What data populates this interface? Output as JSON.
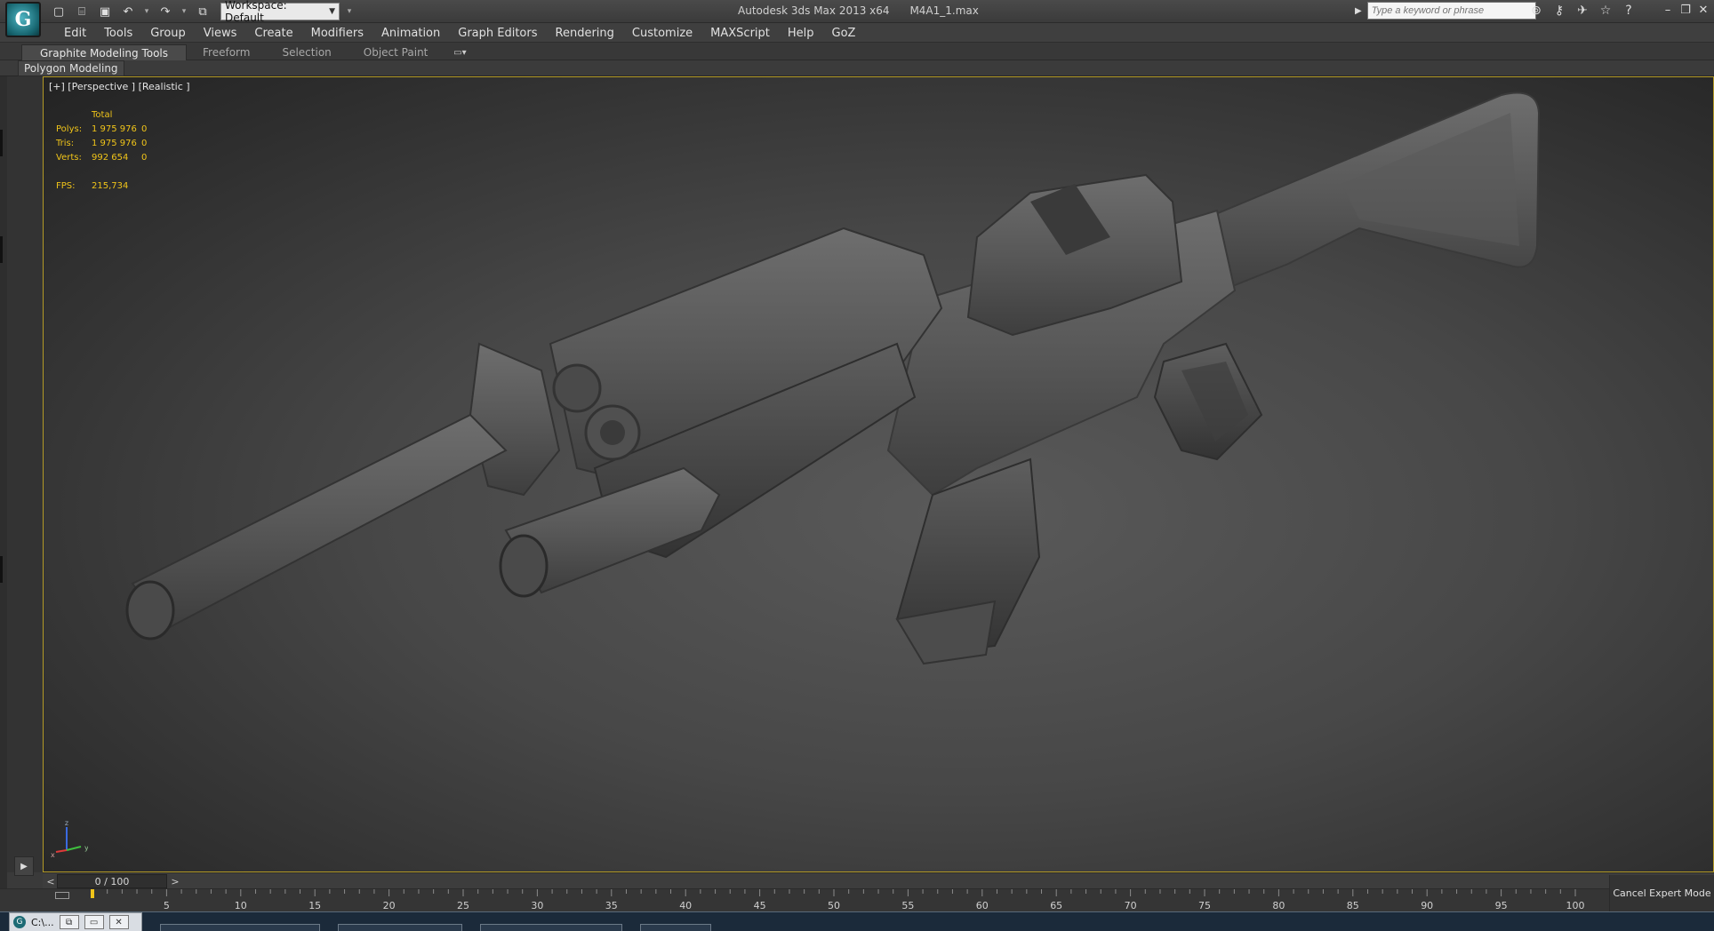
{
  "app": {
    "logo": "G",
    "title": "Autodesk 3ds Max  2013 x64",
    "file": "M4A1_1.max"
  },
  "quick_access": {
    "workspace_label": "Workspace: Default",
    "icons": [
      "new-file-icon",
      "open-folder-icon",
      "save-icon",
      "undo-icon",
      "redo-icon",
      "project-folder-icon"
    ]
  },
  "search": {
    "placeholder": "Type a keyword or phrase"
  },
  "title_icons": [
    "binoculars-icon",
    "key-icon",
    "communication-icon",
    "star-icon",
    "help-icon"
  ],
  "menu": {
    "items": [
      "Edit",
      "Tools",
      "Group",
      "Views",
      "Create",
      "Modifiers",
      "Animation",
      "Graph Editors",
      "Rendering",
      "Customize",
      "MAXScript",
      "Help",
      "GoZ"
    ]
  },
  "ribbon": {
    "tabs": [
      "Graphite Modeling Tools",
      "Freeform",
      "Selection",
      "Object Paint"
    ],
    "active_tab": "Graphite Modeling Tools",
    "panel_label": "Polygon Modeling"
  },
  "viewport": {
    "label": "[+] [Perspective ] [Realistic ]",
    "stats": {
      "header": "Total",
      "rows": [
        {
          "label": "Polys:",
          "value": "1 975 976",
          "selected": "0"
        },
        {
          "label": "Tris:",
          "value": "1 975 976",
          "selected": "0"
        },
        {
          "label": "Verts:",
          "value": "992 654",
          "selected": "0"
        }
      ],
      "fps_label": "FPS:",
      "fps_value": "215,734"
    },
    "gizmo": {
      "z": "z",
      "y": "y",
      "x": "x"
    }
  },
  "timeline": {
    "frame_display": "0 / 100",
    "prev": "<",
    "next": ">",
    "ticks": [
      "5",
      "10",
      "15",
      "20",
      "25",
      "30",
      "35",
      "40",
      "45",
      "50",
      "55",
      "60",
      "65",
      "70",
      "75",
      "80",
      "85",
      "90",
      "95",
      "100"
    ]
  },
  "status": {
    "cancel_expert_mode": "Cancel Expert Mode"
  },
  "taskbar": {
    "item_label": "C:\\...",
    "logo": "G"
  },
  "colors": {
    "accent_yellow": "#f0c419",
    "viewport_border": "#b39a26",
    "ui_dark": "#3a3a3a"
  }
}
